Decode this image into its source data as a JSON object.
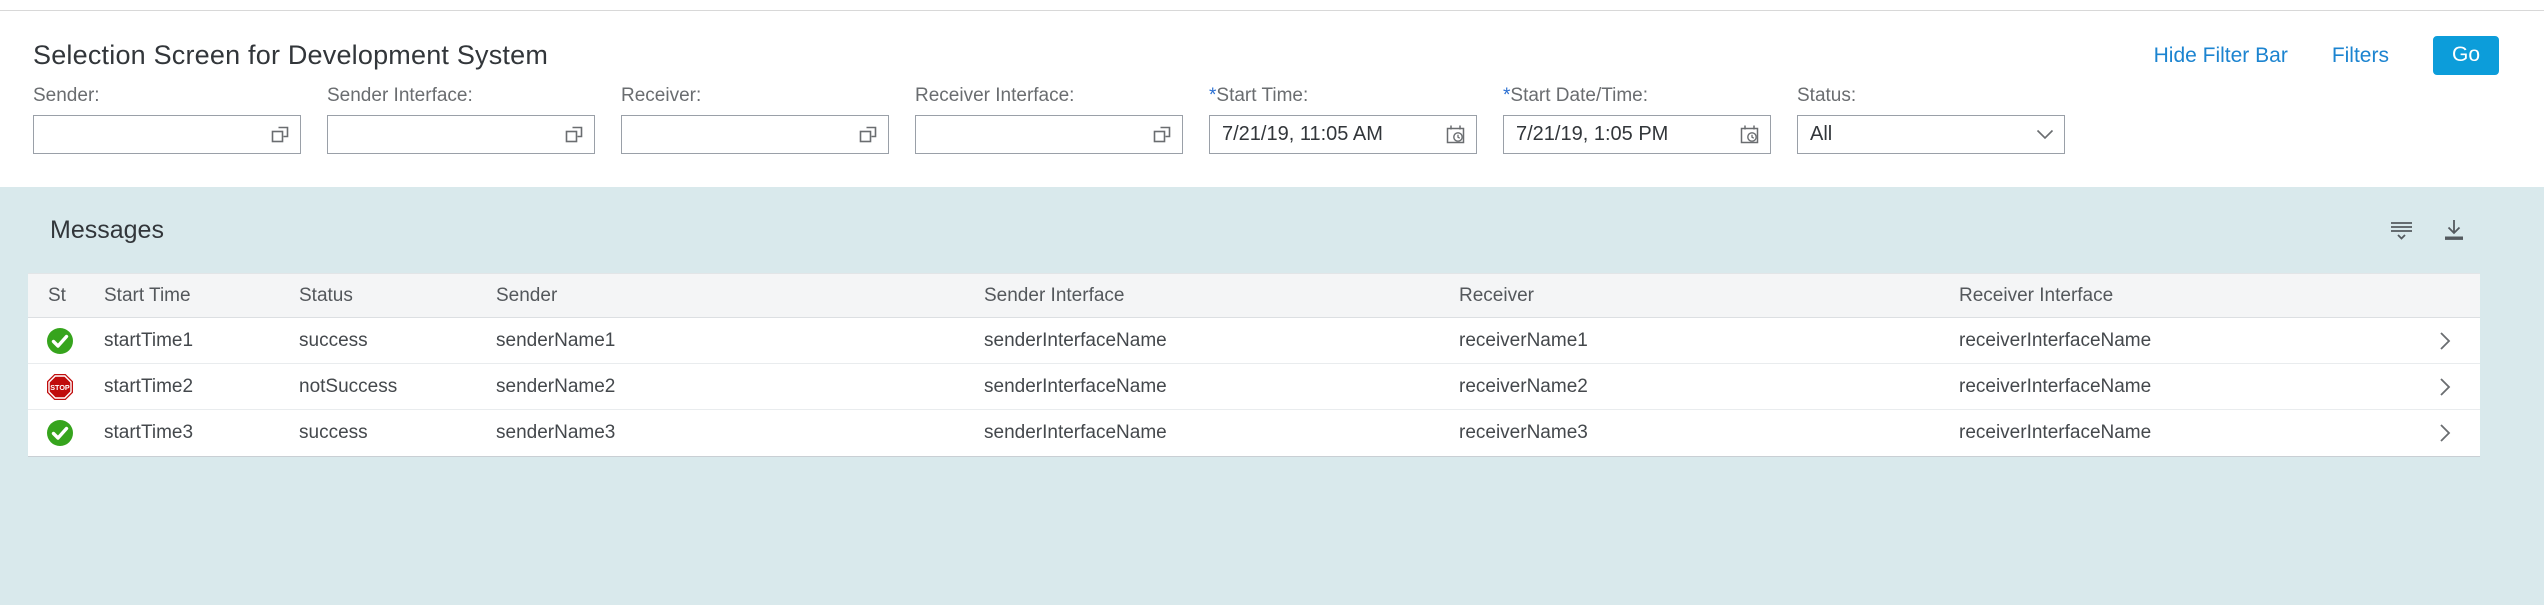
{
  "colors": {
    "accent_link": "#1c84d0",
    "go_button": "#0c9dda",
    "required_star": "#2a6fd2",
    "content_background": "#d9e9ec",
    "success_green": "#36a41d",
    "error_red": "#c00c0c"
  },
  "header": {
    "title": "Selection Screen for Development System",
    "hide_filter_bar_label": "Hide Filter Bar",
    "filters_label": "Filters",
    "go_label": "Go"
  },
  "filter_bar": {
    "fields": [
      {
        "prefix": "",
        "label": "Sender:",
        "value": "",
        "icon": "value-help-icon"
      },
      {
        "prefix": "",
        "label": "Sender Interface:",
        "value": "",
        "icon": "value-help-icon"
      },
      {
        "prefix": "",
        "label": "Receiver:",
        "value": "",
        "icon": "value-help-icon"
      },
      {
        "prefix": "",
        "label": "Receiver Interface:",
        "value": "",
        "icon": "value-help-icon"
      },
      {
        "prefix": "*",
        "label": "Start Time:",
        "value": "7/21/19, 11:05 AM",
        "icon": "datetime-picker-icon"
      },
      {
        "prefix": "*",
        "label": "Start Date/Time:",
        "value": "7/21/19, 1:05 PM",
        "icon": "datetime-picker-icon"
      },
      {
        "prefix": "",
        "label": "Status:",
        "value": "All",
        "icon": "chevron-down-icon"
      }
    ]
  },
  "messages": {
    "title": "Messages",
    "toolbar_icons": [
      "filter-icon",
      "download-icon"
    ],
    "columns": [
      "St",
      "Start Time",
      "Status",
      "Sender",
      "Sender Interface",
      "Receiver",
      "Receiver Interface"
    ],
    "rows": [
      {
        "status_icon": "success",
        "start_time": "startTime1",
        "status": "success",
        "sender": "senderName1",
        "sender_interface": "senderInterfaceName",
        "receiver": "receiverName1",
        "receiver_interface": "receiverInterfaceName"
      },
      {
        "status_icon": "error",
        "start_time": "startTime2",
        "status": "notSuccess",
        "sender": "senderName2",
        "sender_interface": "senderInterfaceName",
        "receiver": "receiverName2",
        "receiver_interface": "receiverInterfaceName"
      },
      {
        "status_icon": "success",
        "start_time": "startTime3",
        "status": "success",
        "sender": "senderName3",
        "sender_interface": "senderInterfaceName",
        "receiver": "receiverName3",
        "receiver_interface": "receiverInterfaceName"
      }
    ]
  }
}
